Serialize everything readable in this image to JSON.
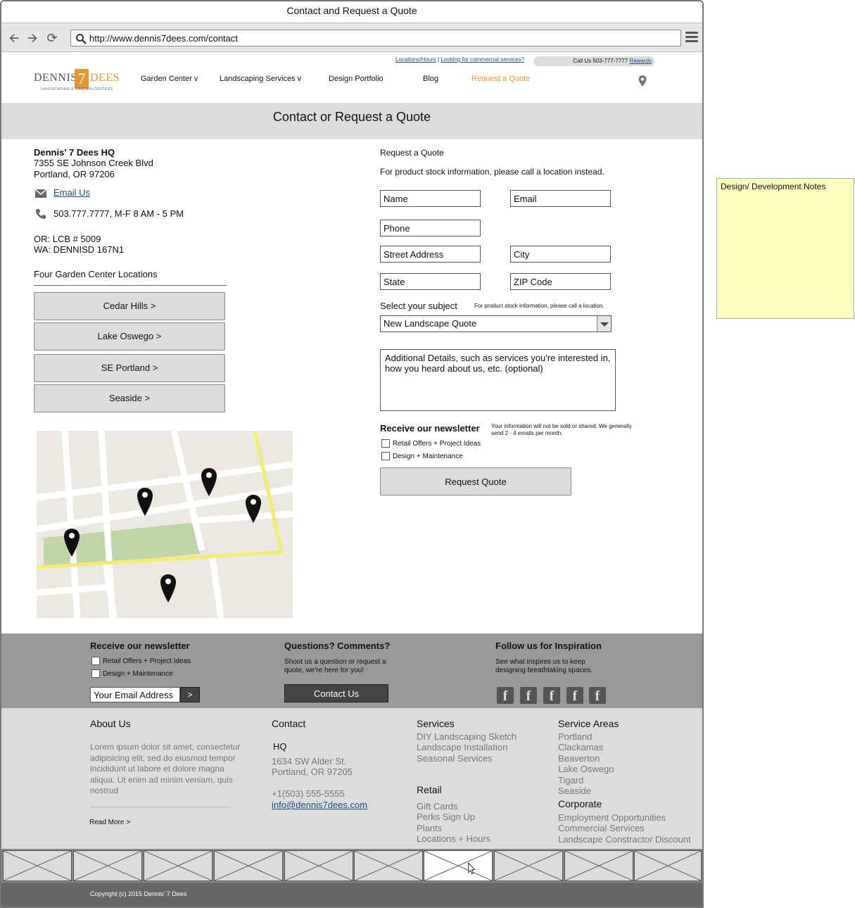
{
  "browser": {
    "title": "Contact and Request a Quote",
    "url": "http://www.dennis7dees.com/contact"
  },
  "header": {
    "util_links": [
      "Locations/Hours",
      "Looking for commercial services?"
    ],
    "call": "Call Us 503-777-7777",
    "rewards": "Rewards",
    "logo": {
      "part1": "DENNIS'",
      "seven": "7",
      "part2": "DEES",
      "sub": "LANDSCAPING & GARDEN CENTERS"
    },
    "nav": [
      {
        "label": "Garden Center v"
      },
      {
        "label": "Landscaping Services v"
      },
      {
        "label": "Design Portfolio"
      },
      {
        "label": "Blog"
      },
      {
        "label": "Request a Quote"
      }
    ]
  },
  "hero": {
    "title": "Contact or Request a Quote"
  },
  "contact": {
    "hq_name": "Dennis' 7 Dees HQ",
    "address1": "7355 SE Johnson Creek Blvd",
    "address2": "Portland, OR 97206",
    "email_label": "Email Us",
    "phone": "503.777.7777, M-F 8 AM - 5 PM",
    "license_or": "OR: LCB # 5009",
    "license_wa": "WA: DENNISD 167N1",
    "locations_heading": "Four Garden Center Locations",
    "locations": [
      "Cedar Hills >",
      "Lake Oswego >",
      "SE Portland >",
      "Seaside >"
    ]
  },
  "form": {
    "heading": "Request a Quote",
    "note": "For product stock information, please call a location instead.",
    "fields": {
      "name": "Name",
      "email": "Email",
      "phone": "Phone",
      "street": "Street Address",
      "city": "City",
      "state": "State",
      "zip": "ZIP Code"
    },
    "subject_label": "Select your subject",
    "subject_note": "For product stock information, please call a location.",
    "subject_value": "New Landscape Quote",
    "details_placeholder": "Additional Details, such as services you're interested in, how you heard about us, etc. (optional)",
    "newsletter_heading": "Receive our newsletter",
    "newsletter_note": "Your information will not be sold or shared. We generally send 2 - 4 emails per month.",
    "options": [
      "Retail Offers + Project Ideas",
      "Design + Maintenance"
    ],
    "submit": "Request Quote"
  },
  "notes": {
    "title": "Design/ Development Notes"
  },
  "footer_top": {
    "newsletter_heading": "Receive our newsletter",
    "options": [
      "Retail Offers + Project Ideas",
      "Design + Maintenance"
    ],
    "email_placeholder": "Your Email Address",
    "go": ">",
    "questions_heading": "Questions? Comments?",
    "questions_text": "Shoot us a question or request a quote, we're here for you!",
    "contact_btn": "Contact Us",
    "follow_heading": "Follow us for Inspiration",
    "follow_text": "See what inspires us to keep designing breathtaking spaces.",
    "social_glyph": "f"
  },
  "footer_links": {
    "about_heading": "About Us",
    "about_text": "Lorem ipsum dolor sit amet, consectetur adipisicing elit, sed do eiusmod tempor incididunt ut labore et dolore magna aliqua. Ut enim ad minim veniam, quis nostrud",
    "read_more": "Read More >",
    "contact_heading": "Contact",
    "hq": "HQ",
    "addr1": "1634 SW Alder St.",
    "addr2": "Portland, OR 97205",
    "phone": "+1(503) 555-5555",
    "email": "info@dennis7dees.com",
    "services_heading": "Services",
    "services": [
      "DIY Landscaping Sketch",
      "Landscape Installation",
      "Seasonal Services"
    ],
    "retail_heading": "Retail",
    "retail": [
      "Gift Cards",
      "Perks Sign Up",
      "Plants",
      "Locations + Hours"
    ],
    "areas_heading": "Service Areas",
    "areas": [
      "Portland",
      "Clackamas",
      "Beaverton",
      "Lake Oswego",
      "Tigard",
      "Seaside"
    ],
    "corporate_heading": "Corporate",
    "corporate": [
      "Employment Opportunities",
      "Commercial Services",
      "Landscape Constractor Discount"
    ]
  },
  "copyright": "Copyright (c) 2015 Dennis' 7 Dees"
}
